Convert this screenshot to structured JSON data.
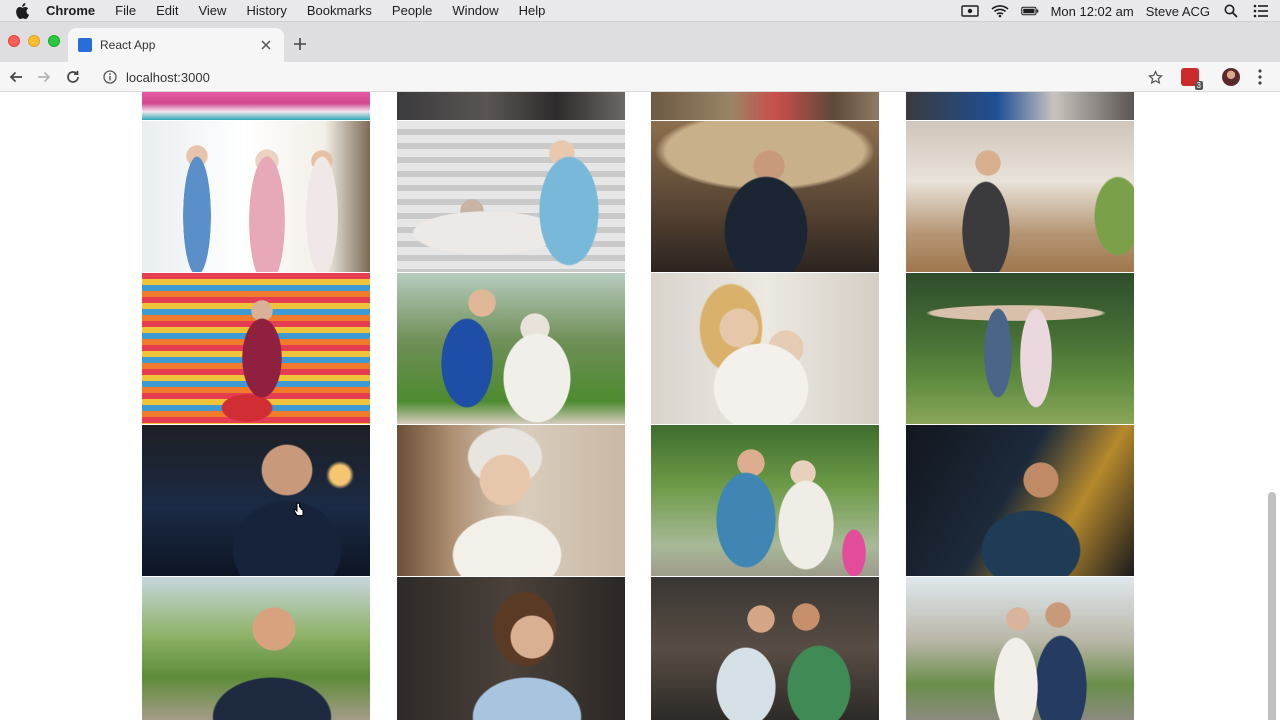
{
  "menubar": {
    "app": "Chrome",
    "items": [
      "File",
      "Edit",
      "View",
      "History",
      "Bookmarks",
      "People",
      "Window",
      "Help"
    ],
    "clock": "Mon 12:02 am",
    "user": "Steve ACG"
  },
  "tab": {
    "title": "React App"
  },
  "toolbar": {
    "url": "localhost:3000",
    "extension_badge": "3"
  },
  "gallery": {
    "rows": [
      [
        "top-pink",
        "top-dark",
        "top-cafe",
        "top-blue"
      ],
      [
        "seniors-dumbbells",
        "nurse-patient",
        "man-phone-cafe",
        "barista-counter"
      ],
      [
        "shopping-aisle",
        "nurse-senior-park",
        "daughter-mother-hug",
        "seniors-yoga"
      ],
      [
        "man-phone-night",
        "senior-glasses-wave",
        "couple-yoga-mats",
        "man-car-night"
      ],
      [
        "man-sunglasses",
        "woman-glasses-cafe",
        "couple-laptop",
        "couple-city"
      ]
    ]
  },
  "colors": {
    "accent": "#2a6dd6",
    "menubar": "#e9e9eb",
    "tabstrip": "#dedee0"
  }
}
